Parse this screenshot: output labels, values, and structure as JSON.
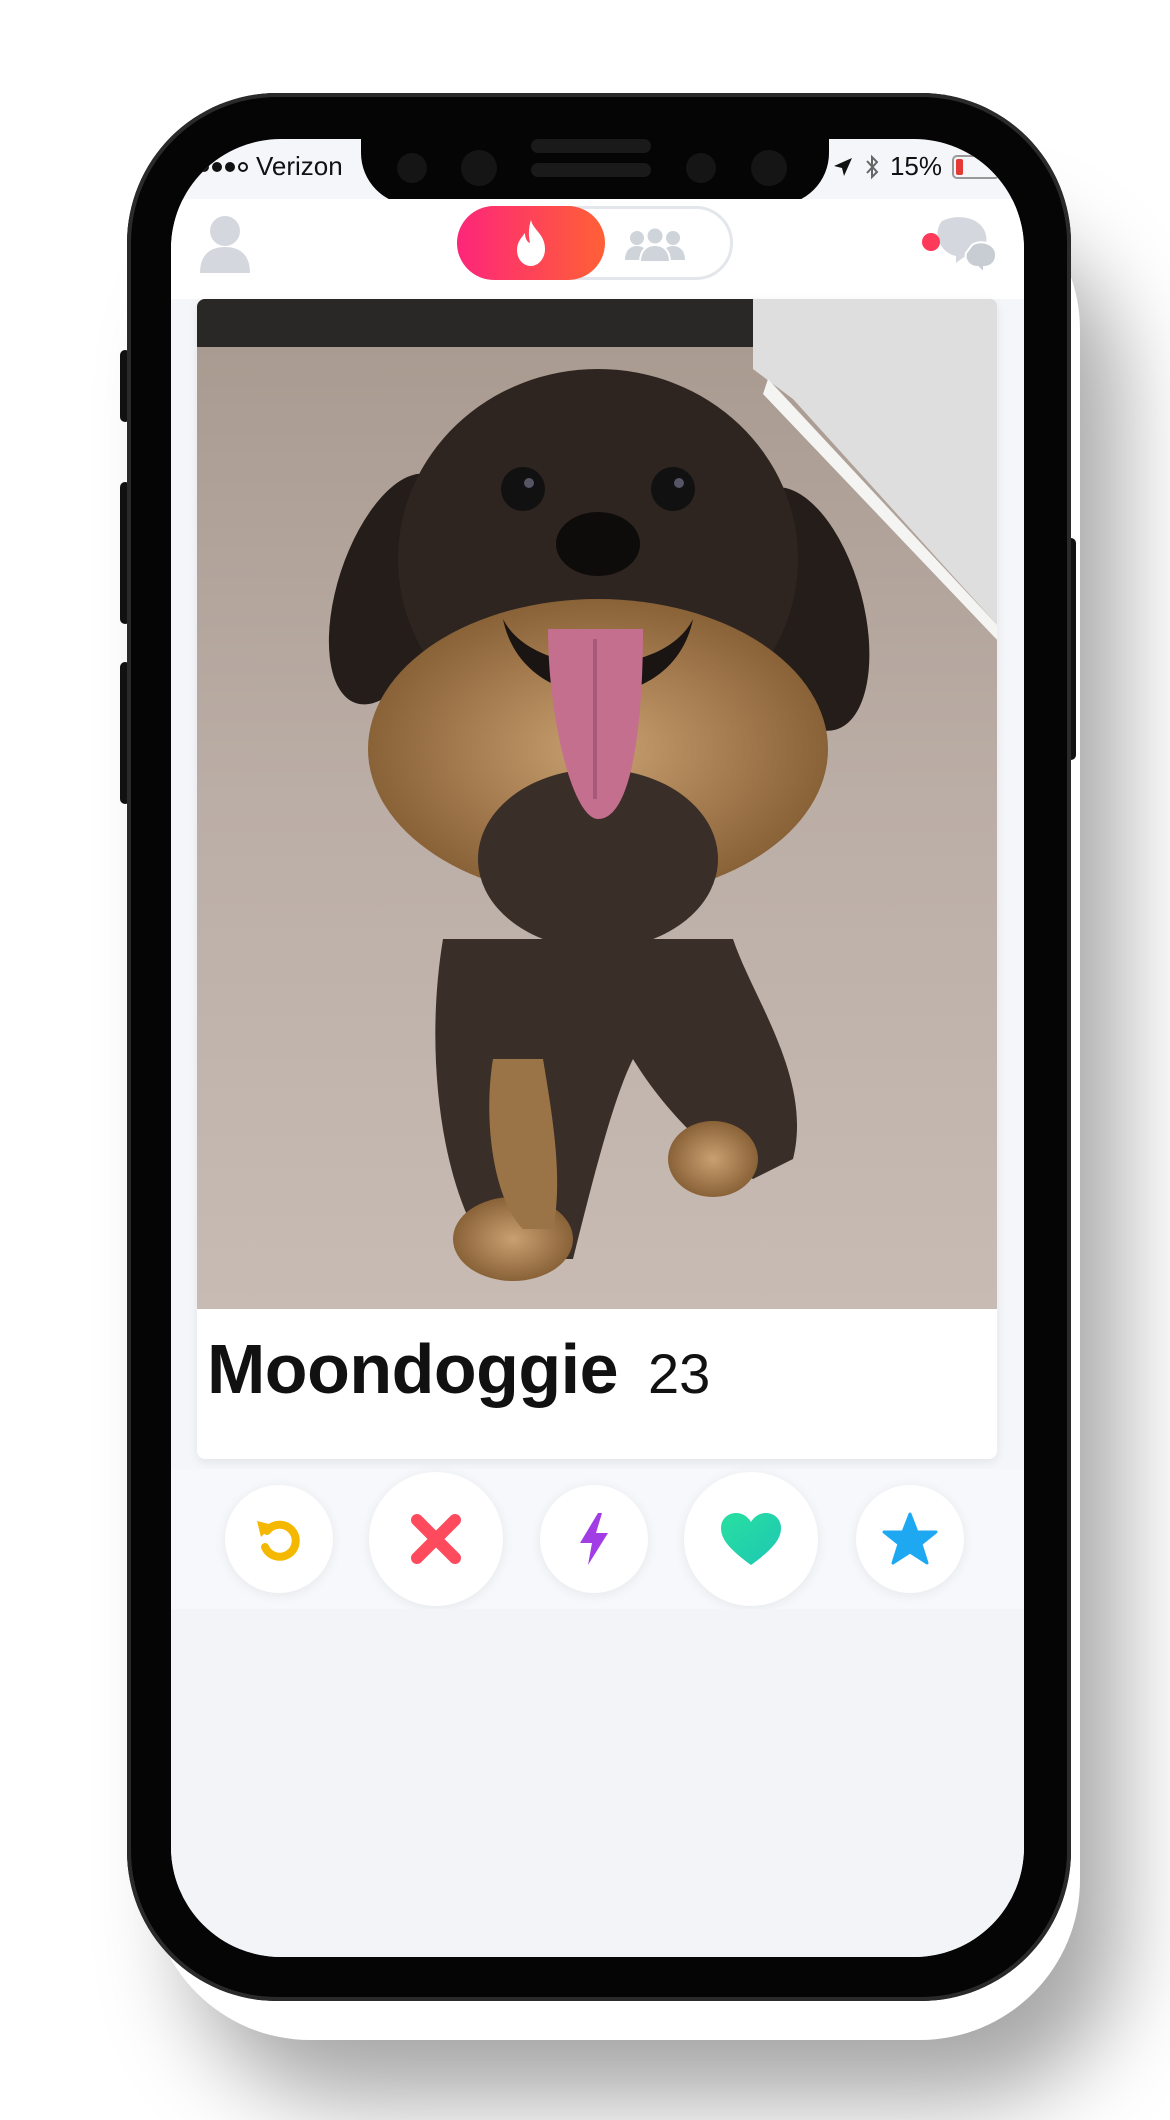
{
  "status_bar": {
    "carrier": "Verizon",
    "battery_percent": "15%",
    "battery_level": 0.15
  },
  "top_bar": {
    "left_icon": "profile-icon",
    "toggle_active": "fire-icon",
    "toggle_inactive": "group-icon",
    "right_icon": "messages-icon",
    "accent_gradient": [
      "#fd267a",
      "#ff6036"
    ]
  },
  "profile_card": {
    "name": "Moondoggie",
    "age": "23",
    "photo": "dog-photo"
  },
  "actions": [
    {
      "icon": "rewind-icon",
      "color": "#f5b800"
    },
    {
      "icon": "nope-icon",
      "color": "#fd4a5c"
    },
    {
      "icon": "boost-icon",
      "color": "#a23ce4"
    },
    {
      "icon": "like-icon",
      "color": "#2ed8a0"
    },
    {
      "icon": "super-like-icon",
      "color": "#1fa8f2"
    }
  ]
}
